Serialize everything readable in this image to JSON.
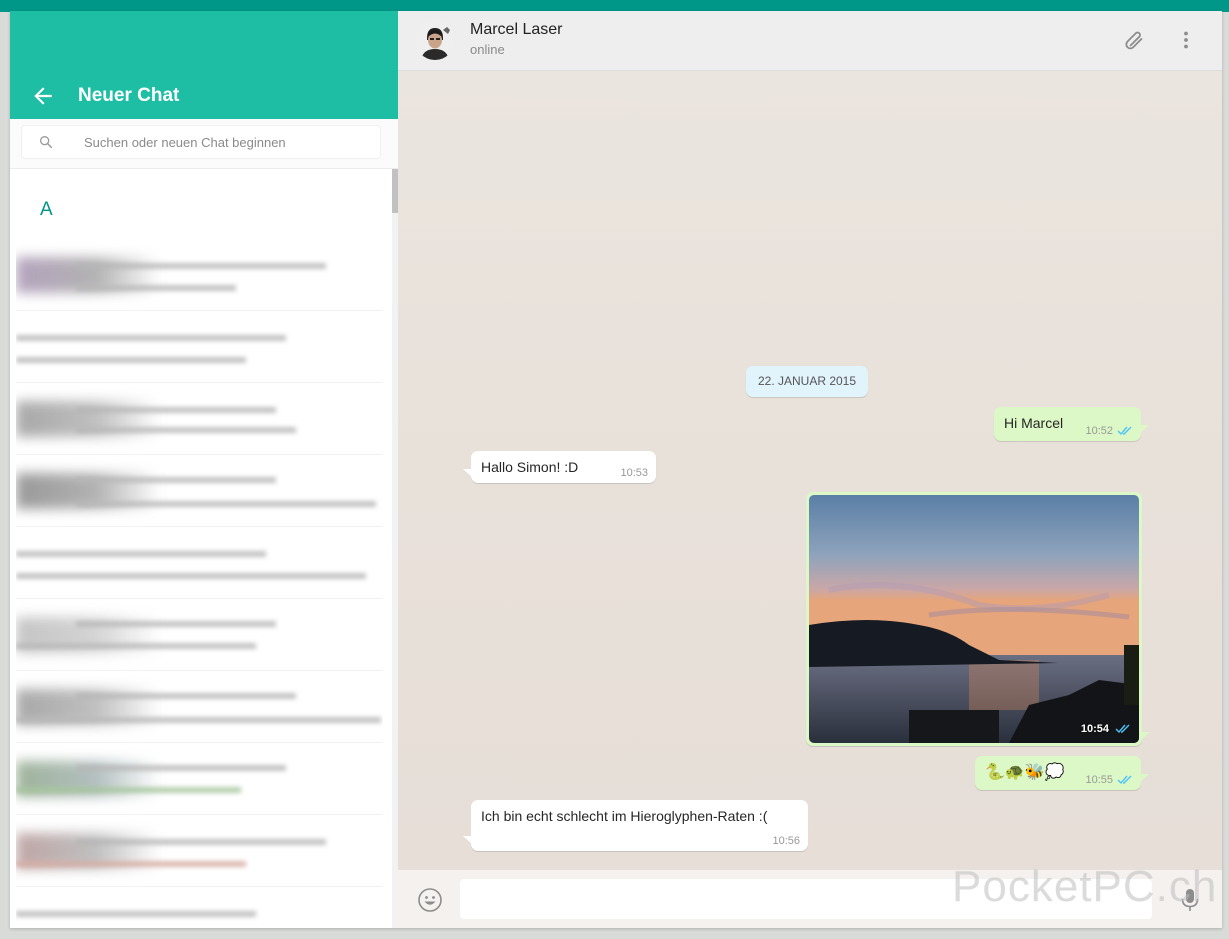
{
  "left_panel": {
    "title": "Neuer Chat",
    "search": {
      "placeholder": "Suchen oder neuen Chat beginnen",
      "value": ""
    },
    "section_letter": "A"
  },
  "chat": {
    "contact_name": "Marcel Laser",
    "contact_status": "online",
    "date_chip": "22. JANUAR 2015",
    "messages": [
      {
        "direction": "out",
        "text": "Hi Marcel",
        "time": "10:52",
        "read": true
      },
      {
        "direction": "in",
        "text": "Hallo Simon! :D",
        "time": "10:53"
      },
      {
        "direction": "out",
        "type": "image",
        "time": "10:54",
        "read": true
      },
      {
        "direction": "out",
        "text": "🐍🐢🐝💭",
        "time": "10:55",
        "read": true
      },
      {
        "direction": "in",
        "text": "Ich bin echt schlecht im Hieroglyphen-Raten :(",
        "time": "10:56"
      }
    ],
    "composer": {
      "placeholder": "",
      "value": ""
    }
  },
  "watermark": "PocketPC.ch",
  "colors": {
    "header_teal": "#1ebea5",
    "top_band": "#009688",
    "outgoing_bubble": "#dcf8c6",
    "incoming_bubble": "#ffffff",
    "read_ticks": "#4fc3f7",
    "date_chip": "#e1f3fb"
  },
  "icons": {
    "back": "arrow-left-icon",
    "search": "magnifier-icon",
    "attach": "paperclip-icon",
    "menu": "more-vertical-icon",
    "emoji": "smiley-icon",
    "mic": "microphone-icon"
  }
}
